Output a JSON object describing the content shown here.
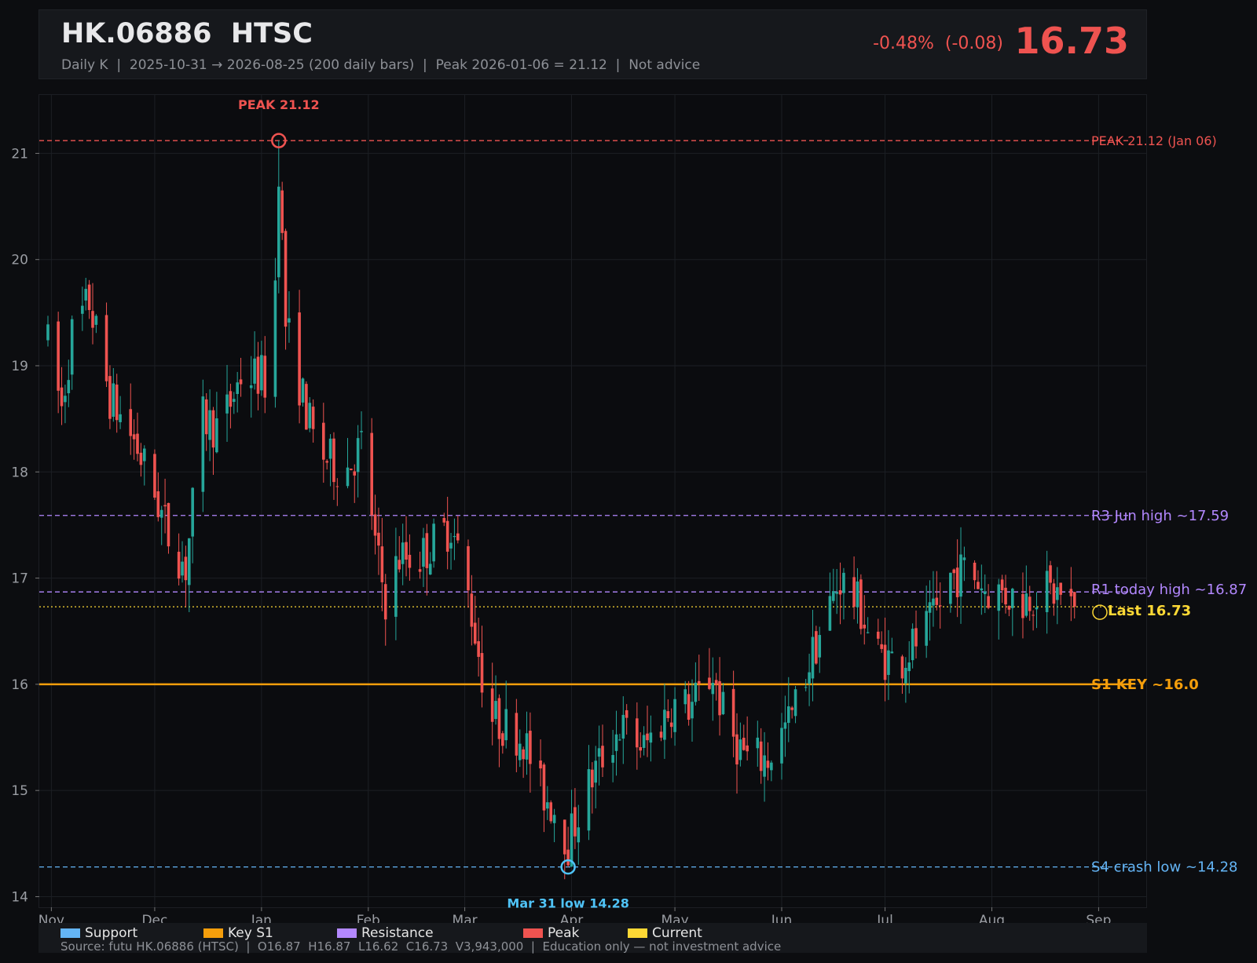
{
  "header": {
    "symbol": "HK.06886  HTSC",
    "subtitle": "Daily K  |  2025-10-31 → 2026-08-25 (200 daily bars)  |  Peak 2026-01-06 = 21.12  |  Not advice",
    "change": "-0.48%  (-0.08)",
    "price": "16.73"
  },
  "legend": {
    "items": [
      {
        "label": "Support",
        "color": "#64b5f6"
      },
      {
        "label": "Key S1",
        "color": "#f59e0b"
      },
      {
        "label": "Resistance",
        "color": "#b388ff"
      },
      {
        "label": "Peak",
        "color": "#ef5350"
      },
      {
        "label": "Current",
        "color": "#fdd835"
      }
    ],
    "source": "Source: futu HK.06886 (HTSC)  |  O16.87  H16.87  L16.62  C16.73  V3,943,000  |  Education only — not investment advice"
  },
  "chart_data": {
    "type": "candlestick",
    "x_start": "2025-10-31",
    "x_end": "2026-08-25",
    "ylim": [
      13.9,
      21.55
    ],
    "yticks": [
      14,
      15,
      16,
      17,
      18,
      19,
      20,
      21
    ],
    "xticks": [
      {
        "date": "2025-11-01",
        "label": "Nov"
      },
      {
        "date": "2025-12-01",
        "label": "Dec"
      },
      {
        "date": "2026-01-01",
        "label": "Jan"
      },
      {
        "date": "2026-02-01",
        "label": "Feb"
      },
      {
        "date": "2026-03-01",
        "label": "Mar"
      },
      {
        "date": "2026-04-01",
        "label": "Apr"
      },
      {
        "date": "2026-05-01",
        "label": "May"
      },
      {
        "date": "2026-06-01",
        "label": "Jun"
      },
      {
        "date": "2026-07-01",
        "label": "Jul"
      },
      {
        "date": "2026-08-01",
        "label": "Aug"
      },
      {
        "date": "2026-09-01",
        "label": "Sep"
      }
    ],
    "up_color": "#26a69a",
    "down_color": "#ef5350",
    "grid": true,
    "levels": [
      {
        "value": 21.12,
        "label": "PEAK 21.12 (Jan 06)",
        "color": "#ef5350",
        "style": "dashed"
      },
      {
        "value": 17.59,
        "label": "R3 Jun high ~17.59",
        "color": "#b388ff",
        "style": "dashed"
      },
      {
        "value": 16.87,
        "label": "R1 today high ~16.87",
        "color": "#b388ff",
        "style": "dashed"
      },
      {
        "value": 16.73,
        "label": "Last 16.73",
        "color": "#fdd835",
        "style": "dotted"
      },
      {
        "value": 16.0,
        "label": "S1 KEY ~16.0",
        "color": "#f59e0b",
        "style": "solid"
      },
      {
        "value": 14.28,
        "label": "S4 crash low ~14.28",
        "color": "#64b5f6",
        "style": "dashed"
      }
    ],
    "annotations": [
      {
        "date": "2026-01-06",
        "value": 21.12,
        "label": "PEAK 21.12",
        "color": "#ef5350",
        "position": "above"
      },
      {
        "date": "2026-03-31",
        "value": 14.28,
        "label": "Mar 31 low 14.28",
        "color": "#4fc3f7",
        "position": "below"
      }
    ],
    "anchors": [
      [
        "2025-10-31",
        19.2
      ],
      [
        "2025-11-04",
        18.6
      ],
      [
        "2025-11-07",
        19.3
      ],
      [
        "2025-11-12",
        19.6
      ],
      [
        "2025-11-18",
        18.7
      ],
      [
        "2025-11-25",
        18.3
      ],
      [
        "2025-12-01",
        17.8
      ],
      [
        "2025-12-05",
        17.4
      ],
      [
        "2025-12-10",
        17.1
      ],
      [
        "2025-12-15",
        18.5
      ],
      [
        "2025-12-20",
        18.4
      ],
      [
        "2025-12-26",
        18.9
      ],
      [
        "2026-01-01",
        18.9
      ],
      [
        "2026-01-03",
        18.8
      ],
      [
        "2026-01-05",
        19.8
      ],
      [
        "2026-01-06",
        20.9
      ],
      [
        "2026-01-08",
        19.4
      ],
      [
        "2026-01-13",
        18.7
      ],
      [
        "2026-01-17",
        18.2
      ],
      [
        "2026-01-25",
        18.0
      ],
      [
        "2026-01-31",
        18.3
      ],
      [
        "2026-02-03",
        17.3
      ],
      [
        "2026-02-06",
        16.8
      ],
      [
        "2026-02-10",
        17.2
      ],
      [
        "2026-02-16",
        17.2
      ],
      [
        "2026-02-25",
        17.5
      ],
      [
        "2026-03-01",
        17.0
      ],
      [
        "2026-03-04",
        16.5
      ],
      [
        "2026-03-08",
        15.7
      ],
      [
        "2026-03-13",
        15.6
      ],
      [
        "2026-03-18",
        15.5
      ],
      [
        "2026-03-23",
        15.0
      ],
      [
        "2026-03-28",
        14.8
      ],
      [
        "2026-03-31",
        14.5
      ],
      [
        "2026-04-03",
        14.8
      ],
      [
        "2026-04-08",
        15.2
      ],
      [
        "2026-04-15",
        15.6
      ],
      [
        "2026-04-22",
        15.4
      ],
      [
        "2026-04-30",
        15.8
      ],
      [
        "2026-05-06",
        15.8
      ],
      [
        "2026-05-12",
        16.1
      ],
      [
        "2026-05-16",
        15.6
      ],
      [
        "2026-05-22",
        15.3
      ],
      [
        "2026-05-28",
        15.3
      ],
      [
        "2026-06-04",
        15.7
      ],
      [
        "2026-06-10",
        16.3
      ],
      [
        "2026-06-18",
        17.0
      ],
      [
        "2026-06-24",
        16.7
      ],
      [
        "2026-06-28",
        16.3
      ],
      [
        "2026-07-05",
        16.2
      ],
      [
        "2026-07-10",
        16.4
      ],
      [
        "2026-07-15",
        16.6
      ],
      [
        "2026-07-20",
        17.0
      ],
      [
        "2026-07-25",
        17.1
      ],
      [
        "2026-07-30",
        16.9
      ],
      [
        "2026-08-05",
        16.85
      ],
      [
        "2026-08-10",
        16.8
      ],
      [
        "2026-08-15",
        16.9
      ],
      [
        "2026-08-20",
        16.85
      ],
      [
        "2026-08-25",
        16.73
      ]
    ],
    "last_bar": {
      "open": 16.87,
      "high": 16.87,
      "low": 16.62,
      "close": 16.73
    },
    "bars": 200
  }
}
